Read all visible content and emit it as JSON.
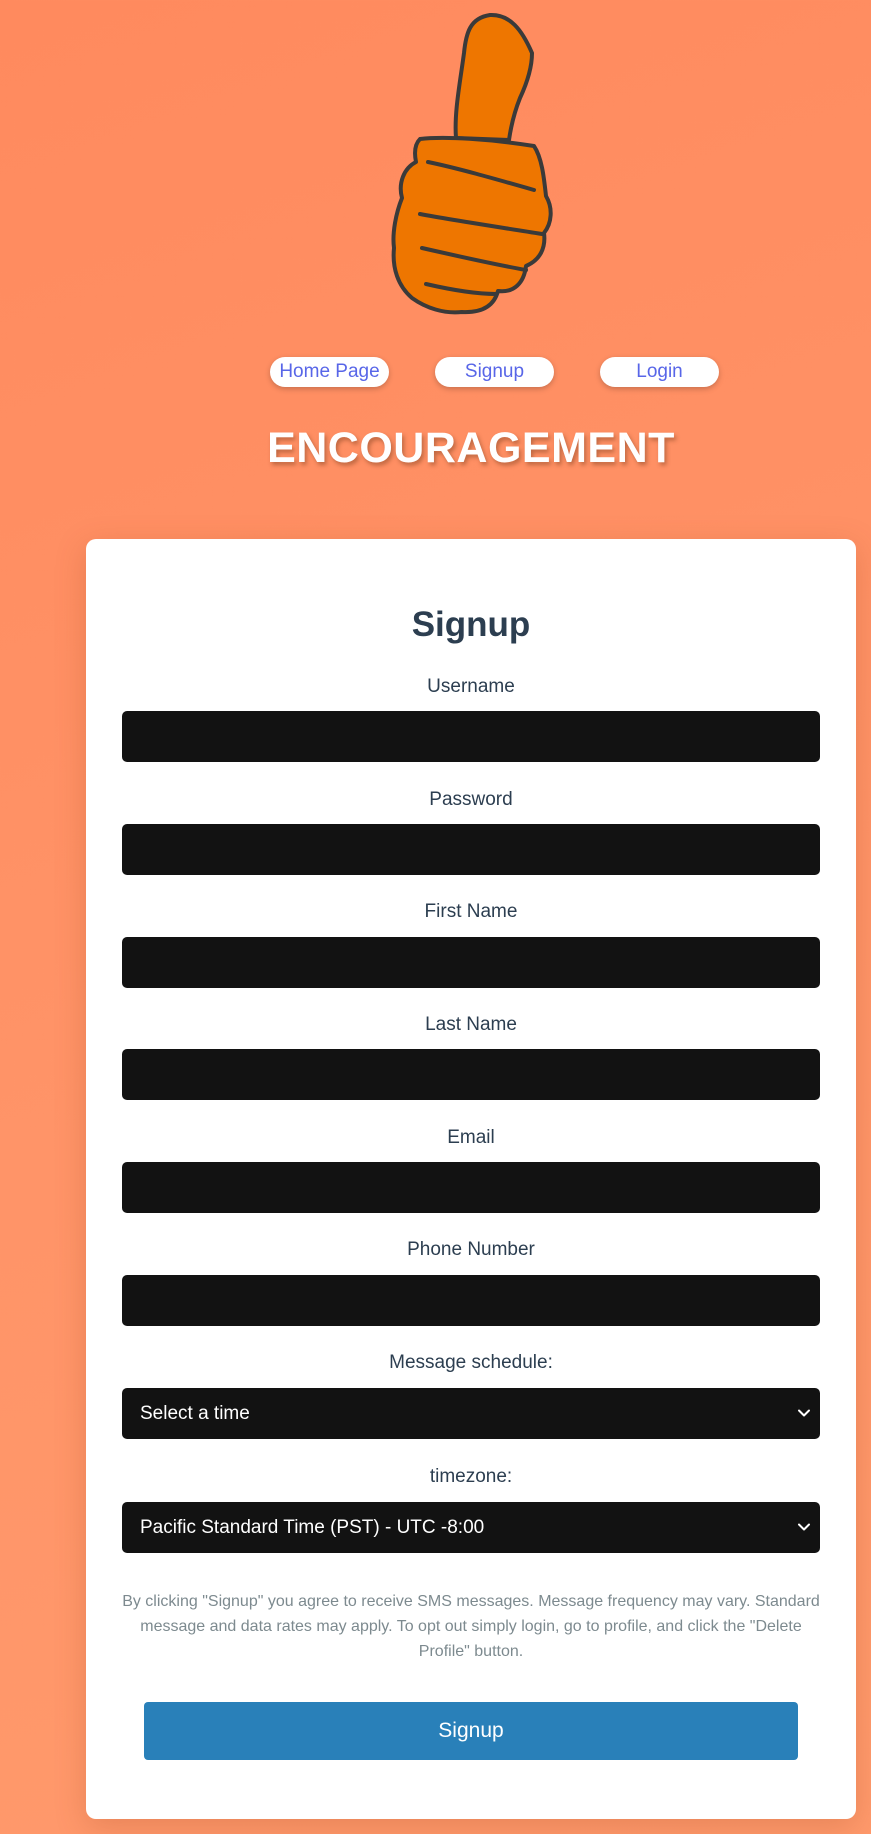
{
  "nav": {
    "items": [
      {
        "label": "Home Page"
      },
      {
        "label": "Signup"
      },
      {
        "label": "Login"
      }
    ]
  },
  "brand": {
    "title": "ENCOURAGEMENT"
  },
  "form": {
    "title": "Signup",
    "fields": {
      "username": {
        "label": "Username",
        "value": ""
      },
      "password": {
        "label": "Password",
        "value": ""
      },
      "first_name": {
        "label": "First Name",
        "value": ""
      },
      "last_name": {
        "label": "Last Name",
        "value": ""
      },
      "email": {
        "label": "Email",
        "value": ""
      },
      "phone": {
        "label": "Phone Number",
        "value": ""
      }
    },
    "schedule": {
      "label": "Message schedule:",
      "selected": "Select a time"
    },
    "timezone": {
      "label": "timezone:",
      "selected": "Pacific Standard Time (PST) - UTC -8:00"
    },
    "disclaimer": "By clicking \"Signup\" you agree to receive SMS messages. Message frequency may vary. Standard message and data rates may apply. To opt out simply login, go to profile, and click the \"Delete Profile\" button.",
    "submit_label": "Signup"
  },
  "icons": {
    "logo": "thumbs-up-icon",
    "select_arrow": "chevron-down-icon"
  },
  "colors": {
    "background": "#ff9066",
    "thumb_fill": "#ee7600",
    "thumb_stroke": "#3a3a3a",
    "nav_text": "#5866e8",
    "input_bg": "#121212",
    "heading_text": "#2c3e50",
    "submit_bg": "#2980b9"
  }
}
